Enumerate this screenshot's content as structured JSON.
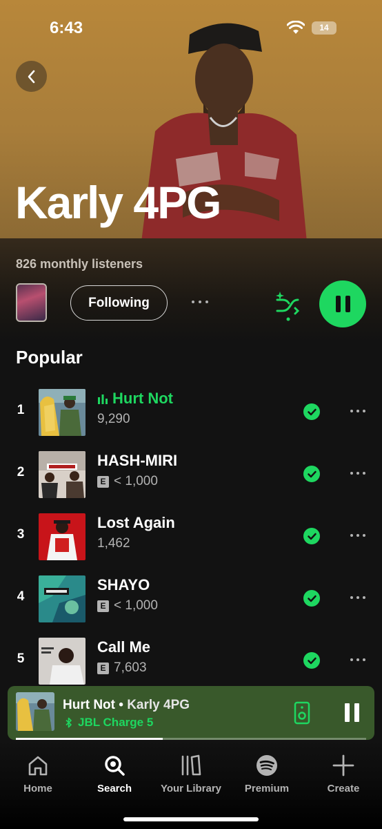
{
  "status_bar": {
    "time": "6:43",
    "battery": "14"
  },
  "artist": {
    "name": "Karly 4PG",
    "monthly_listeners": "826 monthly listeners",
    "follow_label": "Following"
  },
  "popular": {
    "title": "Popular",
    "tracks": [
      {
        "rank": "1",
        "title": "Hurt Not",
        "plays": "9,290",
        "explicit": false,
        "playing": true,
        "downloaded": true
      },
      {
        "rank": "2",
        "title": "HASH-MIRI",
        "plays": "< 1,000",
        "explicit": true,
        "playing": false,
        "downloaded": true
      },
      {
        "rank": "3",
        "title": "Lost Again",
        "plays": "1,462",
        "explicit": false,
        "playing": false,
        "downloaded": true
      },
      {
        "rank": "4",
        "title": "SHAYO",
        "plays": "< 1,000",
        "explicit": true,
        "playing": false,
        "downloaded": true
      },
      {
        "rank": "5",
        "title": "Call Me",
        "plays": "7,603",
        "explicit": true,
        "playing": false,
        "downloaded": true
      }
    ],
    "explicit_badge": "E"
  },
  "now_playing": {
    "title": "Hurt Not",
    "separator": " • ",
    "artist": "Karly 4PG",
    "device": "JBL Charge 5",
    "progress": 0.42
  },
  "nav": {
    "items": [
      {
        "label": "Home",
        "icon": "home-icon",
        "active": false
      },
      {
        "label": "Search",
        "icon": "search-icon",
        "active": true
      },
      {
        "label": "Your Library",
        "icon": "library-icon",
        "active": false
      },
      {
        "label": "Premium",
        "icon": "spotify-icon",
        "active": false
      },
      {
        "label": "Create",
        "icon": "plus-icon",
        "active": false
      }
    ]
  },
  "colors": {
    "accent": "#1ed760",
    "mini_player": "#39592b",
    "hero": "#b8873a"
  }
}
